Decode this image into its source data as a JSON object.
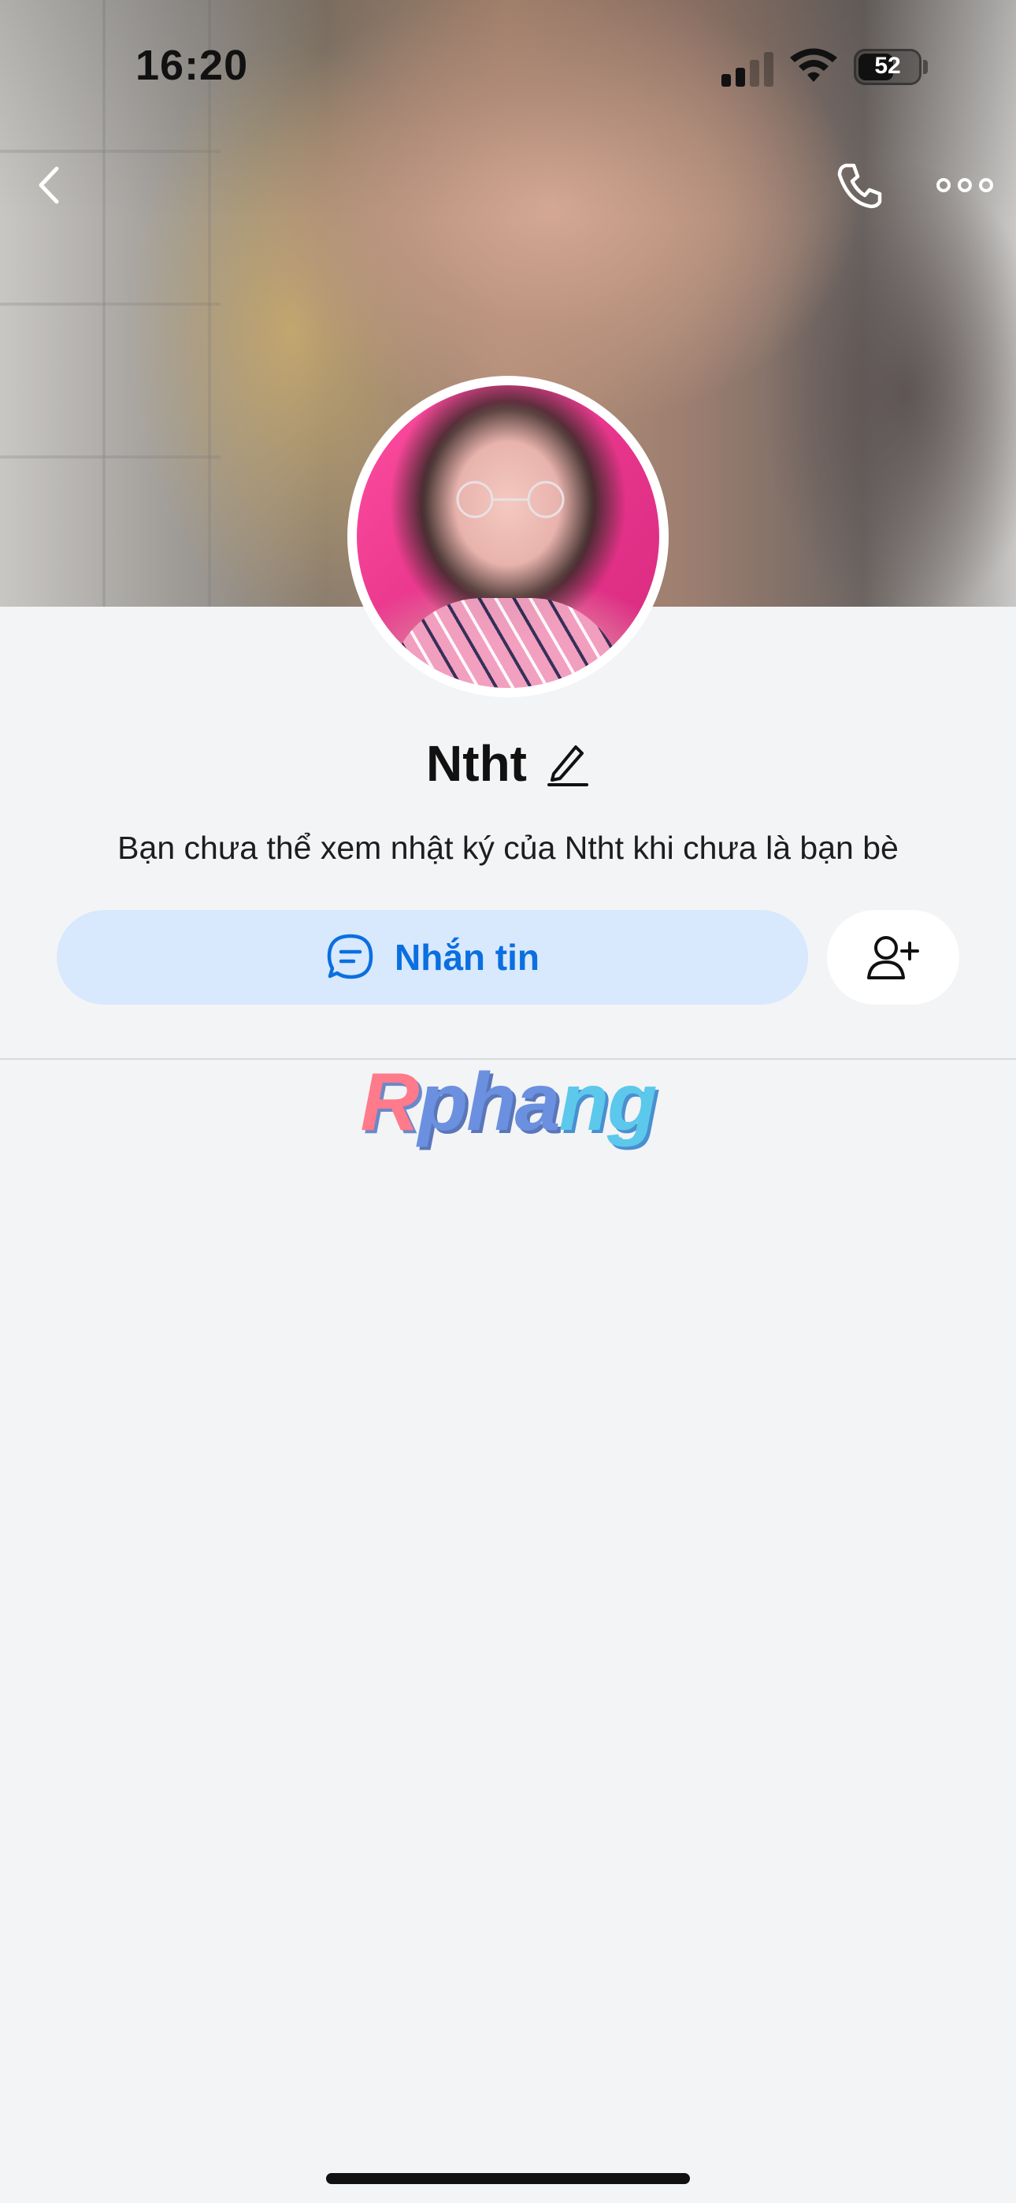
{
  "status_bar": {
    "time": "16:20",
    "battery_level": "52"
  },
  "nav": {
    "back_icon": "chevron-left-icon",
    "call_icon": "phone-icon",
    "more_icon": "more-horizontal-icon"
  },
  "profile": {
    "name": "Ntht",
    "note": "Bạn chưa thể xem nhật ký của Ntht khi chưa là bạn bè"
  },
  "actions": {
    "message_label": "Nhắn tin",
    "message_icon": "chat-bubble-icon",
    "add_friend_icon": "add-friend-icon"
  },
  "watermark": {
    "part1": "R",
    "part2": "pha",
    "part3": "ng"
  },
  "colors": {
    "accent": "#0a6fe0",
    "message_button_bg": "#d8e8fd",
    "page_bg": "#f3f4f6"
  }
}
